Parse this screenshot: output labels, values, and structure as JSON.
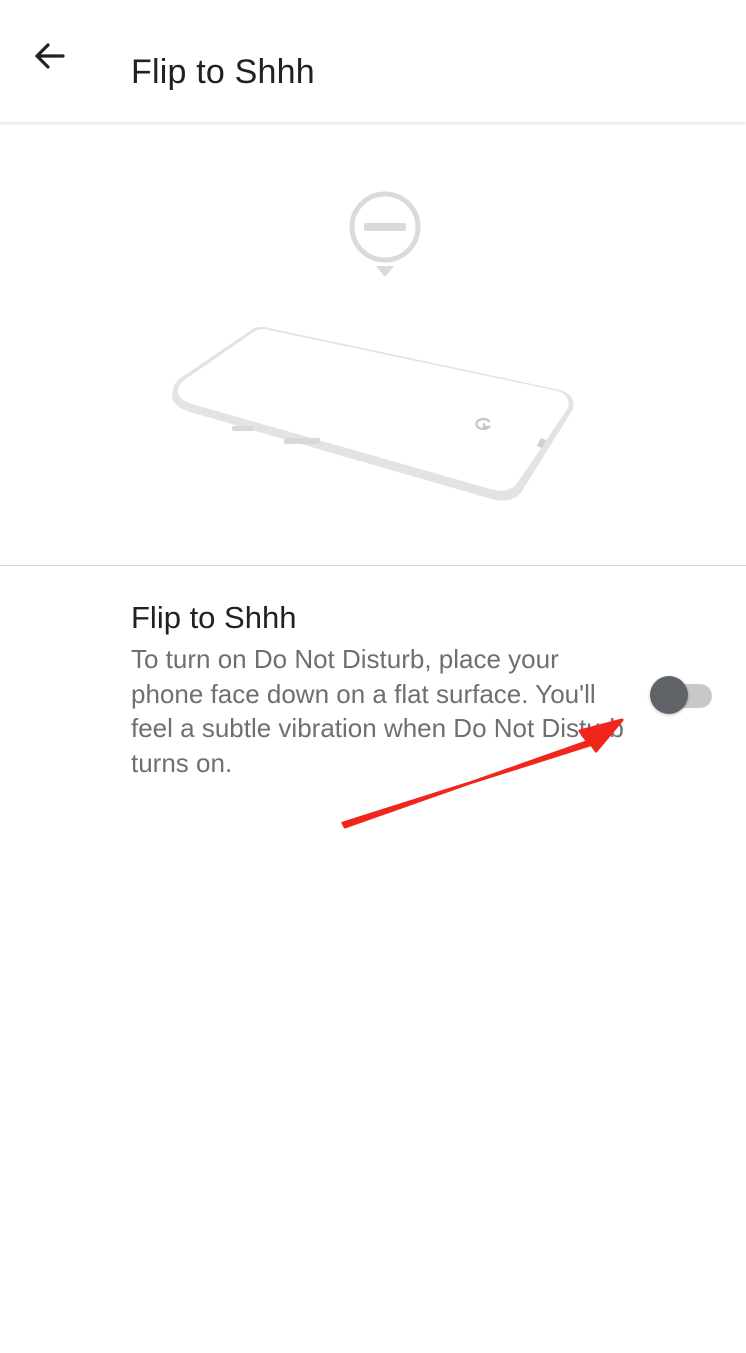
{
  "header": {
    "title": "Flip to Shhh",
    "back_icon": "arrow-back-icon"
  },
  "hero": {
    "icons": [
      "do-not-disturb-icon",
      "phone-face-down-illustration"
    ]
  },
  "setting": {
    "title": "Flip to Shhh",
    "description": "To turn on Do Not Disturb, place your phone face down on a flat surface. You'll feel a subtle vibration when Do Not Disturb turns on.",
    "toggle_state": "off"
  },
  "annotation": {
    "arrow_icon": "red-arrow-icon",
    "color": "#f0261c"
  },
  "colors": {
    "title_text": "#202124",
    "description_text": "#6f6f6f",
    "toggle_thumb": "#5f6368",
    "toggle_track": "#c8c8c8",
    "illustration": "#e3e3e6"
  }
}
